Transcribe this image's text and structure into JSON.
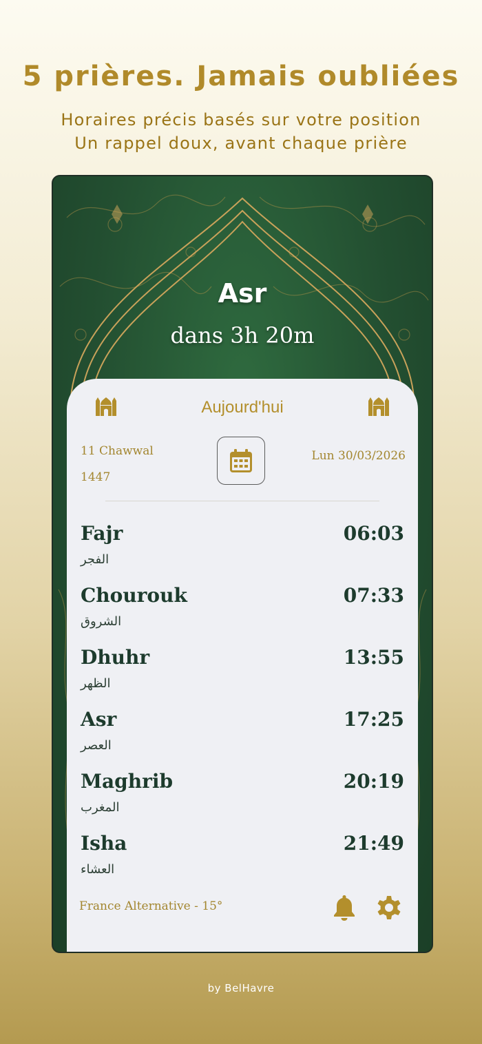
{
  "header": {
    "headline": "5 prières. Jamais oubliées",
    "subline_1": "Horaires précis basés sur votre position",
    "subline_2": "Un rappel doux, avant chaque prière"
  },
  "hero": {
    "next_prayer": "Asr",
    "countdown": "dans 3h 20m"
  },
  "card": {
    "title": "Aujourd'hui",
    "hijri_day_month": "11 Chawwal",
    "hijri_year": "1447",
    "gregorian_date": "Lun 30/03/2026",
    "prayers": [
      {
        "name": "Fajr",
        "arabic": "الفجر",
        "time": "06:03"
      },
      {
        "name": "Chourouk",
        "arabic": "الشروق",
        "time": "07:33"
      },
      {
        "name": "Dhuhr",
        "arabic": "الظهر",
        "time": "13:55"
      },
      {
        "name": "Asr",
        "arabic": "العصر",
        "time": "17:25"
      },
      {
        "name": "Maghrib",
        "arabic": "المغرب",
        "time": "20:19"
      },
      {
        "name": "Isha",
        "arabic": "العشاء",
        "time": "21:49"
      }
    ],
    "calculation_method": "France Alternative - 15°"
  },
  "icons": {
    "left_mosque": "mosque-icon",
    "right_mosque": "mosque-icon",
    "calendar": "calendar-icon",
    "notifications": "bell-icon",
    "settings": "gear-icon"
  },
  "colors": {
    "gold": "#b38f2c",
    "dark_green": "#1d3b2d",
    "background_green": "#234f31",
    "card_bg": "#eff0f4"
  },
  "footer": {
    "credit": "by BelHavre"
  }
}
